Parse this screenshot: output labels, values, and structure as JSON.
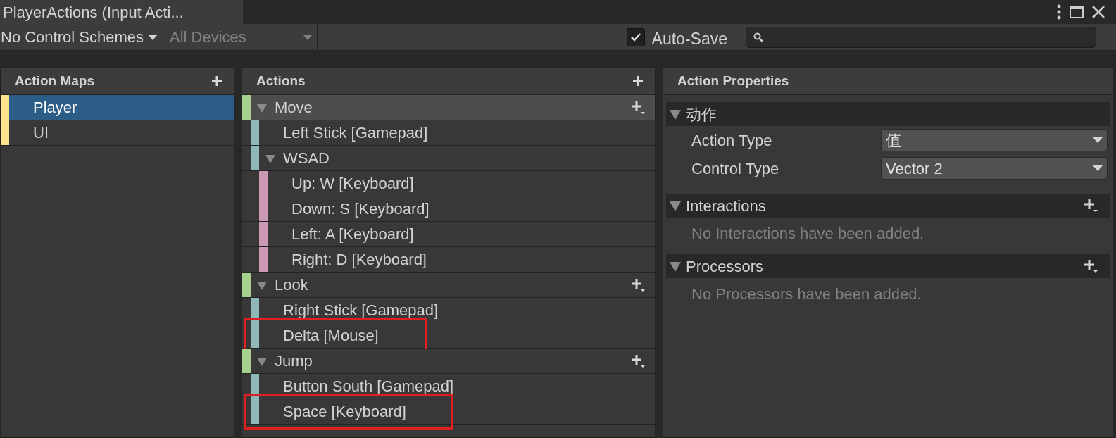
{
  "window": {
    "title": "PlayerActions (Input Acti..."
  },
  "toolbar": {
    "control_scheme": "No Control Schemes",
    "devices": {
      "label": "All Devices",
      "disabled": true
    },
    "auto_save": {
      "label": "Auto-Save",
      "checked": true
    }
  },
  "action_maps": {
    "title": "Action Maps",
    "items": [
      {
        "label": "Player",
        "selected": true
      },
      {
        "label": "UI",
        "selected": false
      }
    ]
  },
  "actions": {
    "title": "Actions",
    "items": [
      {
        "label": "Move",
        "kind": "action",
        "selected": true,
        "expanded": true,
        "highlighted": false,
        "children": [
          {
            "label": "Left Stick [Gamepad]",
            "kind": "binding",
            "selected": false,
            "highlighted": false
          },
          {
            "label": "WSAD",
            "kind": "composite",
            "selected": false,
            "expanded": true,
            "highlighted": false,
            "children": [
              {
                "label": "Up: W [Keyboard]",
                "kind": "part",
                "selected": false,
                "highlighted": false
              },
              {
                "label": "Down: S [Keyboard]",
                "kind": "part",
                "selected": false,
                "highlighted": false
              },
              {
                "label": "Left: A [Keyboard]",
                "kind": "part",
                "selected": false,
                "highlighted": false
              },
              {
                "label": "Right: D [Keyboard]",
                "kind": "part",
                "selected": false,
                "highlighted": false
              }
            ]
          }
        ]
      },
      {
        "label": "Look",
        "kind": "action",
        "selected": false,
        "expanded": true,
        "highlighted": false,
        "children": [
          {
            "label": "Right Stick [Gamepad]",
            "kind": "binding",
            "selected": false,
            "highlighted": false
          },
          {
            "label": "Delta [Mouse]",
            "kind": "binding",
            "selected": false,
            "highlighted": true
          }
        ]
      },
      {
        "label": "Jump",
        "kind": "action",
        "selected": false,
        "expanded": true,
        "highlighted": false,
        "children": [
          {
            "label": "Button South [Gamepad]",
            "kind": "binding",
            "selected": false,
            "highlighted": false
          },
          {
            "label": "Space [Keyboard]",
            "kind": "binding",
            "selected": false,
            "highlighted": true
          }
        ]
      }
    ]
  },
  "properties": {
    "title": "Action Properties",
    "sections": [
      {
        "title": "动作",
        "expanded": true,
        "kind": "fields",
        "fields": [
          {
            "label": "Action Type",
            "value": "值"
          },
          {
            "label": "Control Type",
            "value": "Vector 2"
          }
        ]
      },
      {
        "title": "Interactions",
        "expanded": true,
        "kind": "list",
        "empty": "No Interactions have been added."
      },
      {
        "title": "Processors",
        "expanded": true,
        "kind": "list",
        "empty": "No Processors have been added."
      }
    ]
  }
}
